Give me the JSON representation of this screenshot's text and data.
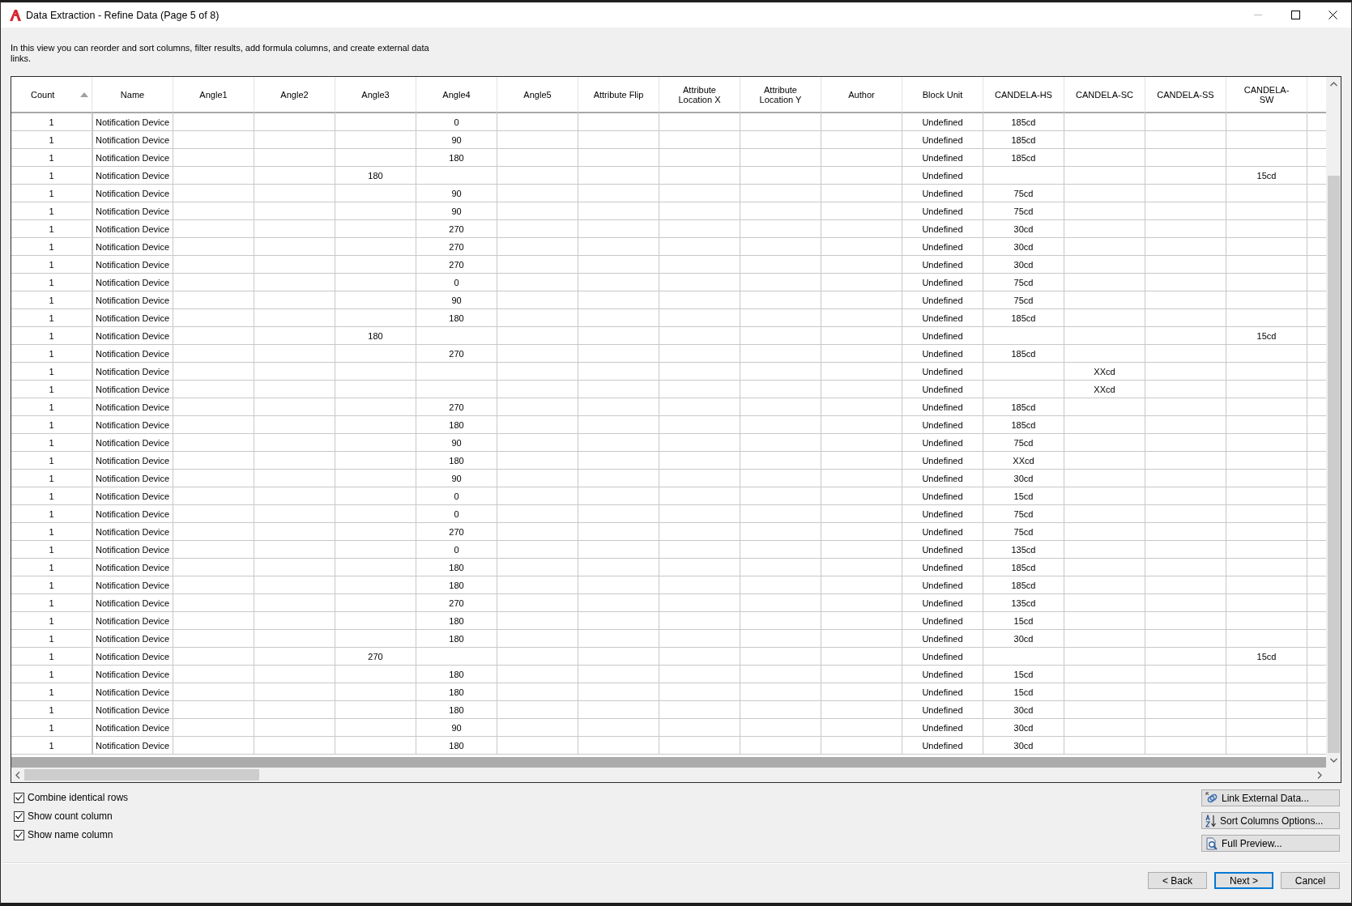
{
  "window": {
    "title": "Data Extraction - Refine Data (Page 5 of 8)"
  },
  "description": "In this view you can reorder and sort columns, filter results, add formula columns, and create external data links.",
  "table": {
    "columns": [
      {
        "label": "Count",
        "sorted": true
      },
      {
        "label": "Name",
        "sorted": false
      },
      {
        "label": "Angle1",
        "sorted": false
      },
      {
        "label": "Angle2",
        "sorted": false
      },
      {
        "label": "Angle3",
        "sorted": false
      },
      {
        "label": "Angle4",
        "sorted": false
      },
      {
        "label": "Angle5",
        "sorted": false
      },
      {
        "label": "Attribute Flip",
        "sorted": false
      },
      {
        "label": "Attribute Location X",
        "sorted": false
      },
      {
        "label": "Attribute Location Y",
        "sorted": false
      },
      {
        "label": "Author",
        "sorted": false
      },
      {
        "label": "Block Unit",
        "sorted": false
      },
      {
        "label": "CANDELA-HS",
        "sorted": false
      },
      {
        "label": "CANDELA-SC",
        "sorted": false
      },
      {
        "label": "CANDELA-SS",
        "sorted": false
      },
      {
        "label": "CANDELA-SW",
        "sorted": false
      }
    ],
    "rows": [
      {
        "count": "1",
        "name": "Notification Device",
        "angle4": "0",
        "block_unit": "Undefined",
        "candela_hs": "185cd"
      },
      {
        "count": "1",
        "name": "Notification Device",
        "angle4": "90",
        "block_unit": "Undefined",
        "candela_hs": "185cd"
      },
      {
        "count": "1",
        "name": "Notification Device",
        "angle4": "180",
        "block_unit": "Undefined",
        "candela_hs": "185cd"
      },
      {
        "count": "1",
        "name": "Notification Device",
        "angle3": "180",
        "block_unit": "Undefined",
        "candela_sw": "15cd"
      },
      {
        "count": "1",
        "name": "Notification Device",
        "angle4": "90",
        "block_unit": "Undefined",
        "candela_hs": "75cd"
      },
      {
        "count": "1",
        "name": "Notification Device",
        "angle4": "90",
        "block_unit": "Undefined",
        "candela_hs": "75cd"
      },
      {
        "count": "1",
        "name": "Notification Device",
        "angle4": "270",
        "block_unit": "Undefined",
        "candela_hs": "30cd"
      },
      {
        "count": "1",
        "name": "Notification Device",
        "angle4": "270",
        "block_unit": "Undefined",
        "candela_hs": "30cd"
      },
      {
        "count": "1",
        "name": "Notification Device",
        "angle4": "270",
        "block_unit": "Undefined",
        "candela_hs": "30cd"
      },
      {
        "count": "1",
        "name": "Notification Device",
        "angle4": "0",
        "block_unit": "Undefined",
        "candela_hs": "75cd"
      },
      {
        "count": "1",
        "name": "Notification Device",
        "angle4": "90",
        "block_unit": "Undefined",
        "candela_hs": "75cd"
      },
      {
        "count": "1",
        "name": "Notification Device",
        "angle4": "180",
        "block_unit": "Undefined",
        "candela_hs": "185cd"
      },
      {
        "count": "1",
        "name": "Notification Device",
        "angle3": "180",
        "block_unit": "Undefined",
        "candela_sw": "15cd"
      },
      {
        "count": "1",
        "name": "Notification Device",
        "angle4": "270",
        "block_unit": "Undefined",
        "candela_hs": "185cd"
      },
      {
        "count": "1",
        "name": "Notification Device",
        "block_unit": "Undefined",
        "candela_sc": "XXcd"
      },
      {
        "count": "1",
        "name": "Notification Device",
        "block_unit": "Undefined",
        "candela_sc": "XXcd"
      },
      {
        "count": "1",
        "name": "Notification Device",
        "angle4": "270",
        "block_unit": "Undefined",
        "candela_hs": "185cd"
      },
      {
        "count": "1",
        "name": "Notification Device",
        "angle4": "180",
        "block_unit": "Undefined",
        "candela_hs": "185cd"
      },
      {
        "count": "1",
        "name": "Notification Device",
        "angle4": "90",
        "block_unit": "Undefined",
        "candela_hs": "75cd"
      },
      {
        "count": "1",
        "name": "Notification Device",
        "angle4": "180",
        "block_unit": "Undefined",
        "candela_hs": "XXcd"
      },
      {
        "count": "1",
        "name": "Notification Device",
        "angle4": "90",
        "block_unit": "Undefined",
        "candela_hs": "30cd"
      },
      {
        "count": "1",
        "name": "Notification Device",
        "angle4": "0",
        "block_unit": "Undefined",
        "candela_hs": "15cd"
      },
      {
        "count": "1",
        "name": "Notification Device",
        "angle4": "0",
        "block_unit": "Undefined",
        "candela_hs": "75cd"
      },
      {
        "count": "1",
        "name": "Notification Device",
        "angle4": "270",
        "block_unit": "Undefined",
        "candela_hs": "75cd"
      },
      {
        "count": "1",
        "name": "Notification Device",
        "angle4": "0",
        "block_unit": "Undefined",
        "candela_hs": "135cd"
      },
      {
        "count": "1",
        "name": "Notification Device",
        "angle4": "180",
        "block_unit": "Undefined",
        "candela_hs": "185cd"
      },
      {
        "count": "1",
        "name": "Notification Device",
        "angle4": "180",
        "block_unit": "Undefined",
        "candela_hs": "185cd"
      },
      {
        "count": "1",
        "name": "Notification Device",
        "angle4": "270",
        "block_unit": "Undefined",
        "candela_hs": "135cd"
      },
      {
        "count": "1",
        "name": "Notification Device",
        "angle4": "180",
        "block_unit": "Undefined",
        "candela_hs": "15cd"
      },
      {
        "count": "1",
        "name": "Notification Device",
        "angle4": "180",
        "block_unit": "Undefined",
        "candela_hs": "30cd"
      },
      {
        "count": "1",
        "name": "Notification Device",
        "angle3": "270",
        "block_unit": "Undefined",
        "candela_sw": "15cd"
      },
      {
        "count": "1",
        "name": "Notification Device",
        "angle4": "180",
        "block_unit": "Undefined",
        "candela_hs": "15cd"
      },
      {
        "count": "1",
        "name": "Notification Device",
        "angle4": "180",
        "block_unit": "Undefined",
        "candela_hs": "15cd"
      },
      {
        "count": "1",
        "name": "Notification Device",
        "angle4": "180",
        "block_unit": "Undefined",
        "candela_hs": "30cd"
      },
      {
        "count": "1",
        "name": "Notification Device",
        "angle4": "90",
        "block_unit": "Undefined",
        "candela_hs": "30cd"
      },
      {
        "count": "1",
        "name": "Notification Device",
        "angle4": "180",
        "block_unit": "Undefined",
        "candela_hs": "30cd"
      }
    ]
  },
  "options": [
    {
      "label": "Combine identical rows",
      "checked": true
    },
    {
      "label": "Show count column",
      "checked": true
    },
    {
      "label": "Show name column",
      "checked": true
    }
  ],
  "side_buttons": [
    {
      "kind": "link",
      "label": "Link External Data..."
    },
    {
      "kind": "sort",
      "label": "Sort Columns Options..."
    },
    {
      "kind": "preview",
      "label": "Full Preview..."
    }
  ],
  "nav_buttons": [
    {
      "label": "< Back",
      "default": false
    },
    {
      "label": "Next >",
      "default": true
    },
    {
      "label": "Cancel",
      "default": false
    }
  ]
}
